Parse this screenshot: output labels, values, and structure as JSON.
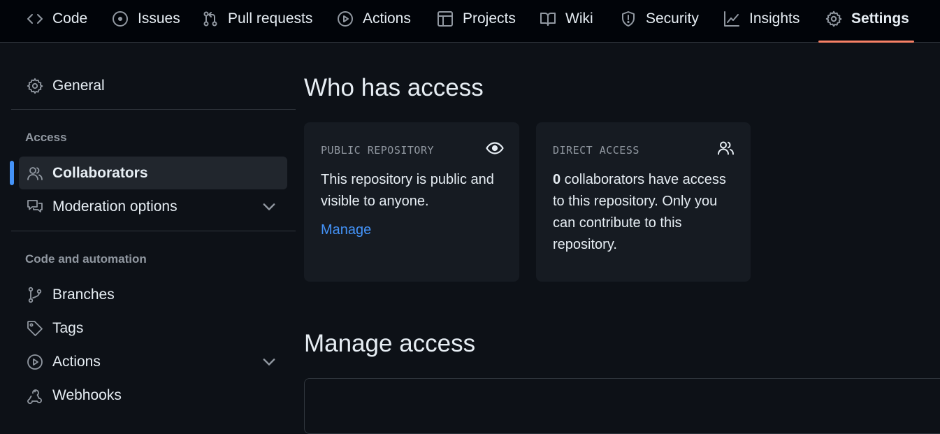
{
  "repo_nav": {
    "tabs": [
      {
        "label": "Code",
        "icon": "code-icon"
      },
      {
        "label": "Issues",
        "icon": "issue-opened-icon"
      },
      {
        "label": "Pull requests",
        "icon": "git-pull-request-icon"
      },
      {
        "label": "Actions",
        "icon": "play-icon"
      },
      {
        "label": "Projects",
        "icon": "table-icon"
      },
      {
        "label": "Wiki",
        "icon": "book-icon"
      },
      {
        "label": "Security",
        "icon": "shield-icon"
      },
      {
        "label": "Insights",
        "icon": "graph-icon"
      },
      {
        "label": "Settings",
        "icon": "gear-icon"
      }
    ],
    "selected": "Settings",
    "accent_color": "#f78166"
  },
  "sidebar": {
    "general": "General",
    "access_heading": "Access",
    "collaborators": "Collaborators",
    "moderation": "Moderation options",
    "code_heading": "Code and automation",
    "branches": "Branches",
    "tags": "Tags",
    "actions": "Actions",
    "webhooks": "Webhooks",
    "active_color": "#4493f8"
  },
  "main": {
    "who_title": "Who has access",
    "public_card": {
      "label": "PUBLIC REPOSITORY",
      "text": "This repository is public and visible to anyone.",
      "link": "Manage",
      "icon": "eye-icon"
    },
    "direct_card": {
      "label": "DIRECT ACCESS",
      "count": "0",
      "text": " collaborators have access to this repository. Only you can contribute to this repository.",
      "icon": "people-icon"
    },
    "manage_title": "Manage access"
  }
}
